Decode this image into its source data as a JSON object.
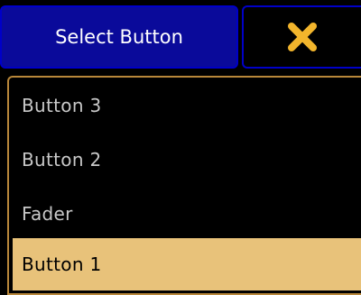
{
  "header": {
    "title": "Select Button",
    "close_icon": "close-x-icon",
    "close_color": "#f2b52c"
  },
  "list": {
    "items": [
      {
        "label": "Button 3",
        "selected": false
      },
      {
        "label": "Button 2",
        "selected": false
      },
      {
        "label": "Fader",
        "selected": false
      },
      {
        "label": "Button 1",
        "selected": true
      }
    ]
  },
  "colors": {
    "title_bg": "#0a0a9a",
    "border_blue": "#0000c8",
    "list_border": "#b8873a",
    "selected_bg": "#e8c27a"
  }
}
